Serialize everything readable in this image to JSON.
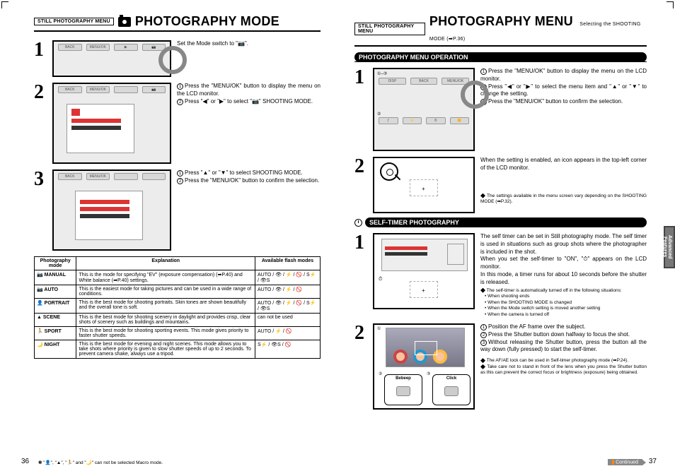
{
  "left": {
    "breadcrumb": "STILL PHOTOGRAPHY MENU",
    "title": "PHOTOGRAPHY MODE",
    "step1": {
      "text": "Set the Mode switch to \"📷\"."
    },
    "step2": {
      "l1": "Press the \"MENU/OK\" button to display the menu on the LCD monitor.",
      "l2": "Press \"◀\" or \"▶\" to select \"📷\" SHOOTING MODE."
    },
    "step3": {
      "l1": "Press \"▲\" or \"▼\" to select SHOOTING MODE.",
      "l2": "Press the \"MENU/OK\" button to confirm the selection."
    },
    "table": {
      "headers": [
        "Photography mode",
        "Explanation",
        "Available flash modes"
      ],
      "rows": [
        {
          "mode": "📷 MANUAL",
          "expl": "This is the mode for specifying \"EV\" (exposure compensation) (➡P.40) and White balance (➡P.40) settings.",
          "flash": "AUTO / 👁 / ⚡ / 🚫 / S⚡ / 👁S"
        },
        {
          "mode": "📷 AUTO",
          "expl": "This is the easiest mode for taking pictures and can be used in a wide range of conditions.",
          "flash": "AUTO / 👁 / ⚡ / 🚫"
        },
        {
          "mode": "👤 PORTRAIT",
          "expl": "This is the best mode for shooting portraits. Skin tones are shown beautifully and the overall tone is soft.",
          "flash": "AUTO / 👁 / ⚡ / 🚫 / S⚡ / 👁S"
        },
        {
          "mode": "▲ SCENE",
          "expl": "This is the best mode for shooting scenery in daylight and provides crisp, clear shots of scenery such as buildings and mountains.",
          "flash": "can not be used"
        },
        {
          "mode": "🏃 SPORT",
          "expl": "This is the best mode for shooting sporting events. This mode gives priority to faster shutter speeds.",
          "flash": "AUTO / ⚡ / 🚫"
        },
        {
          "mode": "🌙 NIGHT",
          "expl": "This is the best mode for evening and night scenes. This mode allows you to take shots where priority is given to slow shutter speeds of up to 2 seconds. To prevent camera shake, always use a tripod.",
          "flash": "S⚡ / 👁S / 🚫"
        }
      ]
    },
    "footnote": "✽ \"👤\", \"▲\", \"🏃\" and \"🌙\" can not be selected Macro mode.",
    "page_num": "36"
  },
  "right": {
    "breadcrumb": "STILL PHOTOGRAPHY MENU",
    "title": "PHOTOGRAPHY MENU",
    "title_sub": "Selecting the SHOOTING MODE (➡P.36)",
    "sec1_hdr": "PHOTOGRAPHY MENU OPERATION",
    "s1_step1": {
      "l1": "Press the \"MENU/OK\" button to display the menu on the LCD monitor.",
      "l2": "Press \"◀\" or \"▶\" to select the menu item and \"▲\" or \"▼\" to change the setting.",
      "l3": "Press the \"MENU/OK\" button to confirm the selection."
    },
    "s1_step2": {
      "text": "When the setting is enabled, an icon appears in the top-left corner of the LCD monitor.",
      "note": "The settings available in the menu screen vary depending on the SHOOTING MODE (➡P.32)."
    },
    "sec2_hdr": "SELF-TIMER PHOTOGRAPHY",
    "s2_step1": {
      "p1": "The self timer can be set in Still photography mode. The self timer is used in situations such as group shots where the photographer is included in the shot.",
      "p2": "When you set the self-timer to \"ON\", \"⏱\" appears on the LCD monitor.",
      "p3": "In this mode, a timer runs for about 10 seconds before the shutter is released.",
      "note_intro": "The self-timer is automatically turned off in the following situations:",
      "notes": [
        "When shooting ends",
        "When the SHOOTING MODE is changed",
        "When the Mode switch setting is moved another setting",
        "When the camera is turned off"
      ]
    },
    "s2_step2": {
      "l1": "Position the AF frame over the subject.",
      "l2": "Press the Shutter button down halfway to focus the shot.",
      "l3": "Without releasing the Shutter button, press the button all the way down (fully pressed) to start the self-timer.",
      "note1": "The AF/AE lock can be used in Self-timer photography mode (➡P.24).",
      "note2": "Take care not to stand in front of the lens when you press the Shutter button as this can prevent the correct focus or brightness (exposure) being obtained.",
      "beep": "Bebeep",
      "click": "Click"
    },
    "side_tab": "Advanced Features",
    "continued": "Continued",
    "page_num": "37"
  }
}
